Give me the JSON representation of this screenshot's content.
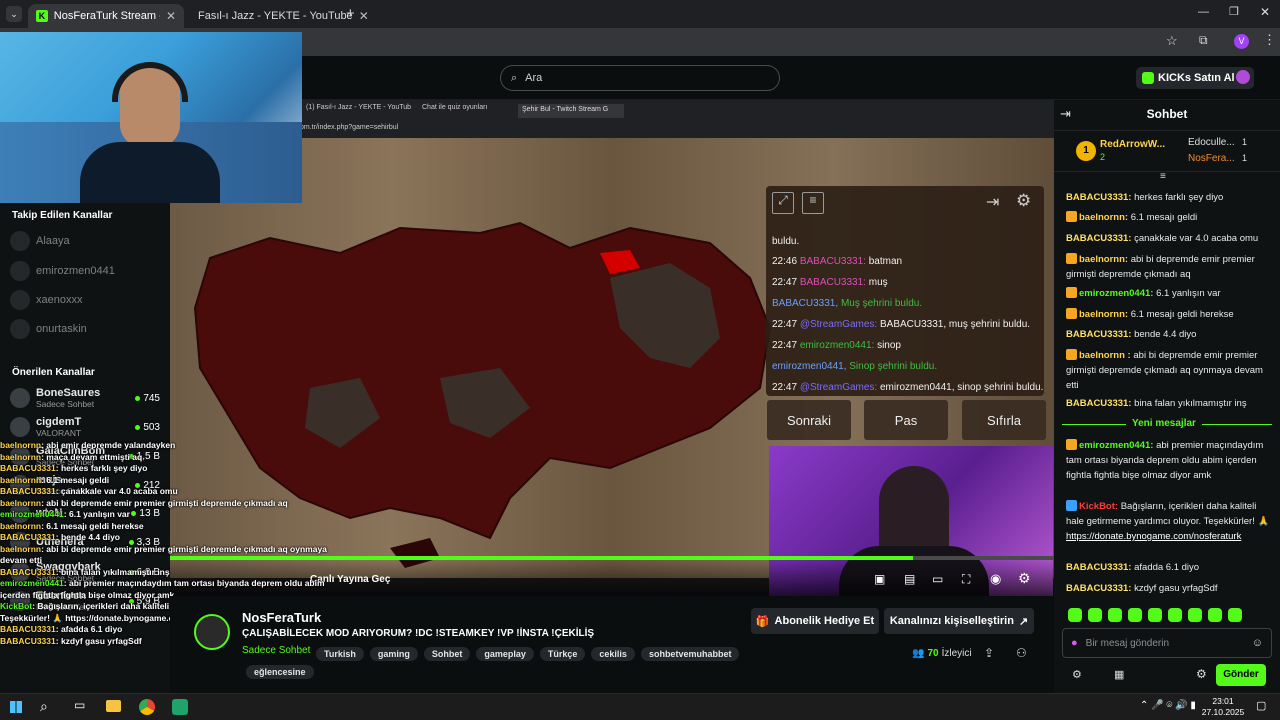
{
  "browser": {
    "tabs": [
      {
        "label": "NosFeraTurk Stream - Watch Li"
      },
      {
        "label": "Fasıl-ı Jazz - YEKTE - YouTube"
      }
    ]
  },
  "site": {
    "search_placeholder": "Ara",
    "kicks_button": "KICKs Satın Al",
    "brand_colour": "#53fc18"
  },
  "sidebar": {
    "following_title": "Takip Edilen Kanallar",
    "following": [
      {
        "name": "Alaaya"
      },
      {
        "name": "emirozmen0441"
      },
      {
        "name": "xaenoxxx"
      },
      {
        "name": "onurtaskin"
      }
    ],
    "recommended_title": "Önerilen Kanallar",
    "recommended": [
      {
        "name": "BoneSaures",
        "sub": "Sadece Sohbet",
        "viewers": "745"
      },
      {
        "name": "cigdemT",
        "sub": "VALORANT",
        "viewers": "503"
      },
      {
        "name": "GalaCimBom",
        "sub": "Sadece Sohbet",
        "viewers": "1,5 B"
      },
      {
        "name": "mujs",
        "sub": "Sadece Sohbet",
        "viewers": "212"
      },
      {
        "name": "wtcN",
        "sub": "",
        "viewers": "13 B"
      },
      {
        "name": "Uthenera",
        "sub": "",
        "viewers": "3,3 B"
      },
      {
        "name": "Swaggybark",
        "sub": "Sadece Sohbet",
        "viewers": "6,8 B"
      },
      {
        "name": "Ebonivon",
        "sub": "RV There Yet?",
        "viewers": "5,9 B"
      }
    ]
  },
  "overlay_chat": [
    {
      "user": "baelnornn",
      "text": "abi emir depremde yalandayken"
    },
    {
      "user": "baelnornn",
      "text": "maça devam ettmişti aq"
    },
    {
      "user": "BABACU3331",
      "text": "herkes farklı şey diyo"
    },
    {
      "user": "baelnornn",
      "text": "6.1 mesajı geldi"
    },
    {
      "user": "BABACU3331",
      "text": "çanakkale var 4.0 acaba omu"
    },
    {
      "user": "baelnornn",
      "text": "abi bi depremde emir premier girmişti depremde çıkmadı aq"
    },
    {
      "user": "emirozmen0441",
      "text": "6.1 yanlışın var"
    },
    {
      "user": "baelnornn",
      "text": "6.1 mesajı geldi herekse"
    },
    {
      "user": "BABACU3331",
      "text": "bende 4.4 diyo"
    },
    {
      "user": "baelnornn",
      "text": "abi bi depremde emir premier girmişti depremde çıkmadı aq oynmaya devam etti"
    },
    {
      "user": "BABACU3331",
      "text": "bina falan yıkılmamıştır inş"
    },
    {
      "user": "emirozmen0441",
      "text": "abi premier maçındaydım tam ortası biyanda deprem oldu abim içerden fightla fightla bişe olmaz diyor amk"
    },
    {
      "user": "KickBot",
      "text": "Bağışların, içerikleri daha kaliteli hale getirmeme yardımcı oluyor. Teşekkürler! 🙏 https://donate.bynogame.com/nosferaturk"
    },
    {
      "user": "BABACU3331",
      "text": "afadda 6.1 diyo"
    },
    {
      "user": "BABACU3331",
      "text": "kzdyf gasu yrfagSdf"
    }
  ],
  "player": {
    "inner_tabs": [
      "(1) Fasıl-ı Jazz - YEKTE - YouTub",
      "Chat ile quiz oyunları",
      "Şehir Bul - Twitch Stream G"
    ],
    "inner_url": "om.tr/index.php?game=sehirbul",
    "quiz_messages": [
      {
        "time": "",
        "user": "",
        "text": "buldu."
      },
      {
        "time": "22:46",
        "user": "BABACU3331:",
        "text": "batman"
      },
      {
        "time": "22:47",
        "user": "BABACU3331:",
        "text": "muş"
      },
      {
        "time": "",
        "user": "BABACU3331,",
        "text": "Muş şehrini buldu."
      },
      {
        "time": "22:47",
        "user": "@StreamGames:",
        "text": "BABACU3331, muş şehrini buldu."
      },
      {
        "time": "22:47",
        "user": "emirozmen0441:",
        "text": "sinop"
      },
      {
        "time": "",
        "user": "emirozmen0441,",
        "text": "Sinop şehrini buldu."
      },
      {
        "time": "22:47",
        "user": "@StreamGames:",
        "text": "emirozmen0441, sinop şehrini buldu."
      }
    ],
    "buttons": {
      "next": "Sonraki",
      "pass": "Pas",
      "reset": "Sıfırla"
    },
    "go_live": "Canlı Yayına Geç"
  },
  "stream": {
    "channel": "NosFeraTurk",
    "title": "ÇALIŞABİLECEK MOD ARIYORUM? !DC !STEAMKEY !VP !İNSTA !ÇEKİLİŞ",
    "category": "Sadece Sohbet",
    "tags": [
      "Turkish",
      "gaming",
      "Sohbet",
      "gameplay",
      "Türkçe",
      "cekilis",
      "sohbetvemuhabbet",
      "eğlencesine"
    ],
    "gift_sub": "Abonelik Hediye Et",
    "customize": "Kanalınızı kişiselleştirin",
    "viewers": "70",
    "viewers_label": "İzleyici"
  },
  "chat": {
    "title": "Sohbet",
    "leaderboard": [
      {
        "rank": "1",
        "name": "RedArrowW...",
        "count": "2"
      },
      {
        "rank": "",
        "name": "Edoculle...",
        "count": "1"
      },
      {
        "rank": "",
        "name": "NosFera...",
        "count": "1"
      }
    ],
    "messages": [
      {
        "user": "BABACU3331:",
        "text": "herkes farklı şey diyo"
      },
      {
        "user": "baelnornn:",
        "text": "6.1 mesajı geldi"
      },
      {
        "user": "BABACU3331:",
        "text": "çanakkale var 4.0 acaba omu"
      },
      {
        "user": "baelnornn:",
        "text": "abi bi depremde emir premier girmişti depremde çıkmadı aq"
      },
      {
        "user": "emirozmen0441:",
        "text": "6.1 yanlışın var"
      },
      {
        "user": "baelnornn:",
        "text": "6.1 mesajı geldi herekse"
      },
      {
        "user": "BABACU3331:",
        "text": "bende 4.4 diyo"
      },
      {
        "user": "baelnornn :",
        "text": "abi bi depremde emir premier girmişti depremde çıkmadı aq oynmaya devam etti"
      },
      {
        "user": "BABACU3331:",
        "text": "bina falan yıkılmamıştır inş"
      }
    ],
    "new_messages": "Yeni mesajlar",
    "messages2": [
      {
        "user": "emirozmen0441:",
        "text": "abi premier maçındaydım tam ortası biyanda deprem oldu abim içerden fightla fightla bişe olmaz diyor amk"
      },
      {
        "user": "KickBot:",
        "text": "Bağışların, içerikleri daha kaliteli hale getirmeme yardımcı oluyor. Teşekkürler! 🙏",
        "link": "https://donate.bynogame.com/nosferaturk"
      },
      {
        "user": "BABACU3331:",
        "text": "afadda 6.1 diyo"
      },
      {
        "user": "BABACU3331:",
        "text": "kzdyf gasu yrfagSdf"
      }
    ],
    "input_placeholder": "Bir mesaj gönderin",
    "send": "Gönder"
  },
  "taskbar": {
    "time": "23:01",
    "date": "27.10.2025"
  }
}
